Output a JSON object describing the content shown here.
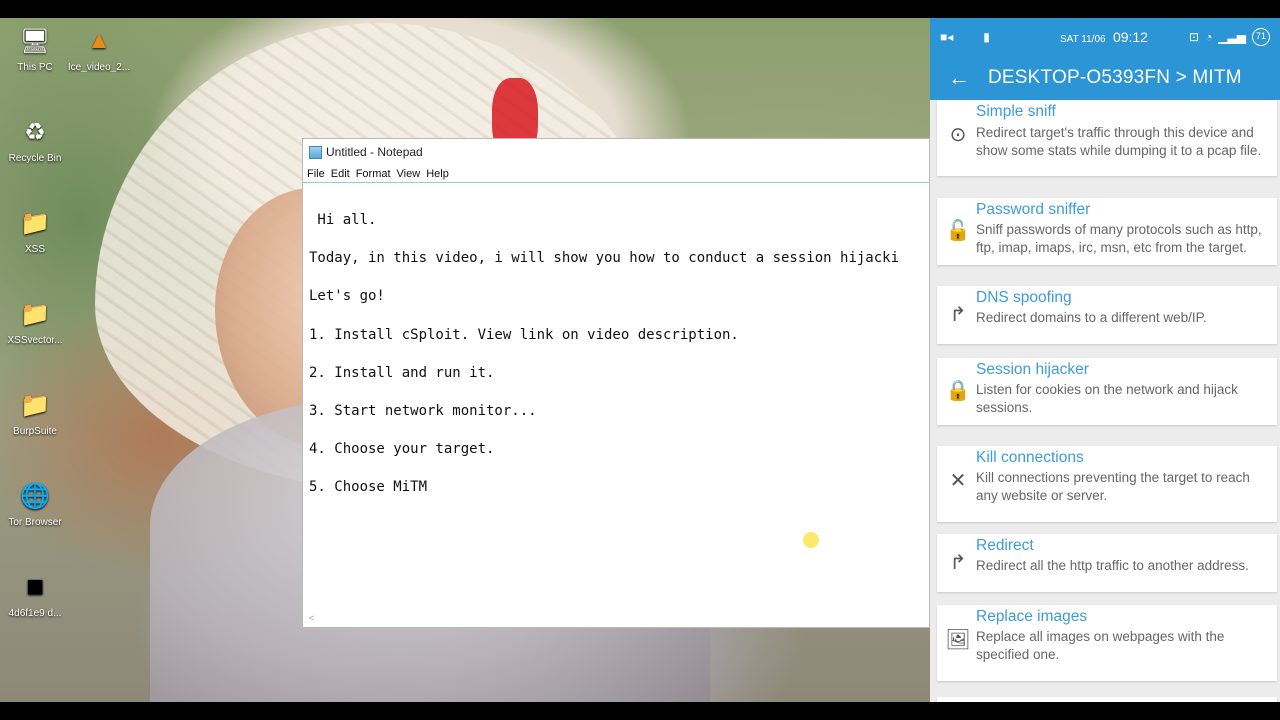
{
  "desktop": {
    "icons": [
      {
        "label": "This PC",
        "icon": "computer-icon",
        "glyph": "🖥"
      },
      {
        "label": "Ice_video_2...",
        "icon": "vlc-cone-icon",
        "glyph": "▲"
      },
      {
        "label": "Recycle Bin",
        "icon": "recycle-bin-icon",
        "glyph": "♻"
      },
      {
        "label": "XSS",
        "icon": "folder-icon",
        "glyph": "📁"
      },
      {
        "label": "XSSvector...",
        "icon": "folder-icon",
        "glyph": "📁"
      },
      {
        "label": "BurpSuite",
        "icon": "folder-icon",
        "glyph": "📁"
      },
      {
        "label": "Tor Browser",
        "icon": "tor-browser-icon",
        "glyph": "🌐"
      },
      {
        "label": "4d6f1e9 d...",
        "icon": "file-icon",
        "glyph": "■"
      }
    ]
  },
  "notepad": {
    "title": "Untitled - Notepad",
    "menu": [
      "File",
      "Edit",
      "Format",
      "View",
      "Help"
    ],
    "lines": [
      " Hi all.",
      "Today, in this video, i will show you how to conduct a session hijacki",
      "Let's go!",
      "1. Install cSploit. View link on video description.",
      "2. Install and run it.",
      "3. Start network monitor...",
      "4. Choose your target.",
      "5. Choose MiTM"
    ],
    "scroll_hint": "<"
  },
  "phone": {
    "status": {
      "date": "SAT 11/06",
      "time": "09:12",
      "battery": "71",
      "accent": "#2b95d6"
    },
    "appbar_title": "DESKTOP-O5393FN > MITM",
    "back_glyph": "←",
    "items": [
      {
        "title": "Simple sniff",
        "desc": "Redirect target's traffic through this device and show some stats while dumping it to a pcap file.",
        "icon": "crosshair-icon",
        "glyph": "⊙"
      },
      {
        "title": "Password sniffer",
        "desc": "Sniff passwords of many protocols such as http, ftp, imap, imaps, irc, msn, etc from the target.",
        "icon": "unlocked-padlock-icon",
        "glyph": "🔓"
      },
      {
        "title": "DNS spoofing",
        "desc": "Redirect domains to a different web/IP.",
        "icon": "split-arrow-icon",
        "glyph": "↱"
      },
      {
        "title": "Session hijacker",
        "desc": "Listen for cookies on the network and hijack sessions.",
        "icon": "padlock-icon",
        "glyph": "🔒"
      },
      {
        "title": "Kill connections",
        "desc": "Kill connections preventing the target to reach any website or server.",
        "icon": "close-icon",
        "glyph": "✕"
      },
      {
        "title": "Redirect",
        "desc": "Redirect all the http traffic to another address.",
        "icon": "split-arrow-icon",
        "glyph": "↱"
      },
      {
        "title": "Replace images",
        "desc": "Replace all images on webpages with the specified one.",
        "icon": "image-icon",
        "glyph": "🖼"
      }
    ]
  }
}
